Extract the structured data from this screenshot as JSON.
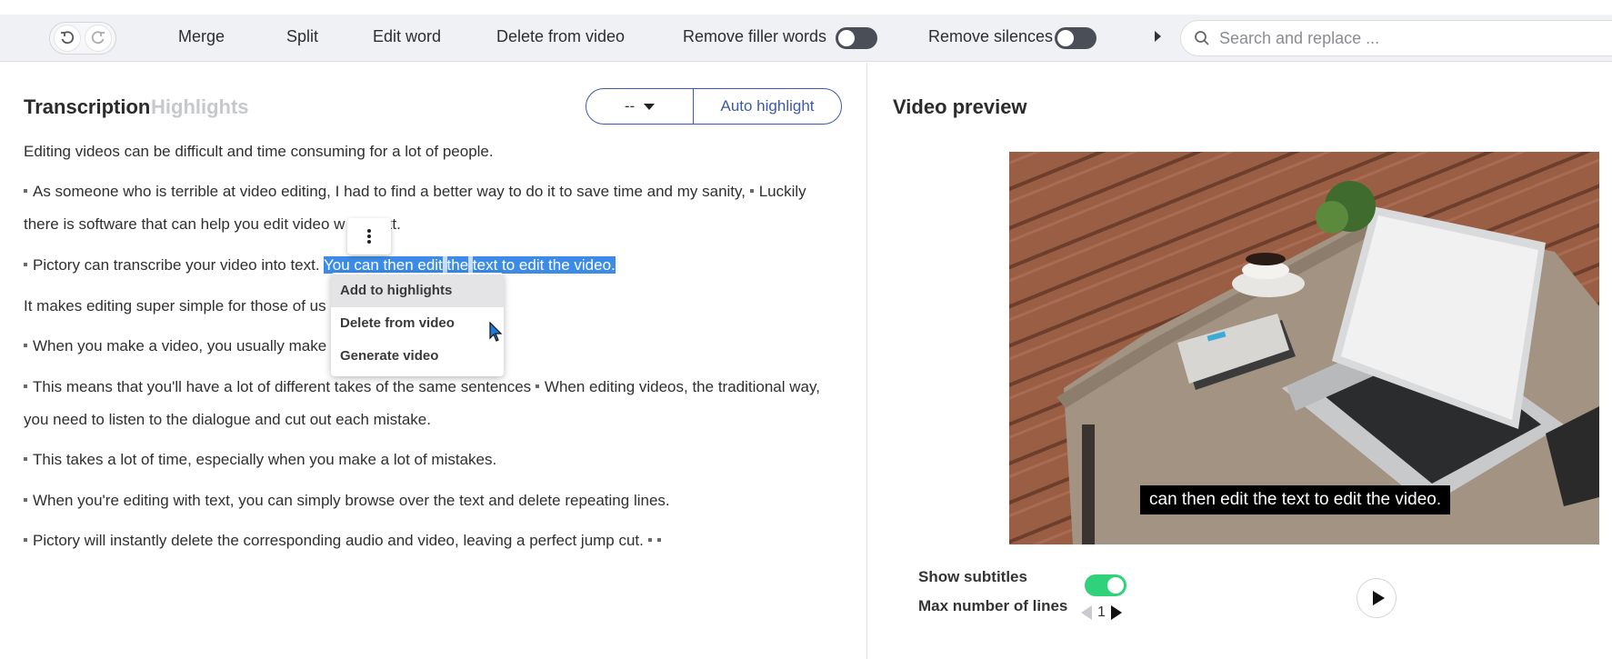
{
  "toolbar": {
    "merge": "Merge",
    "split": "Split",
    "edit_word": "Edit word",
    "delete_from_video": "Delete from video",
    "remove_filler_words": "Remove filler words",
    "remove_filler_words_on": false,
    "remove_silences": "Remove silences",
    "remove_silences_on": false,
    "search_placeholder": "Search and replace ..."
  },
  "transcription": {
    "tab_transcription": "Transcription",
    "tab_highlights": "Highlights",
    "highlight_select": "--",
    "auto_highlight": "Auto highlight",
    "p1": "Editing videos can be difficult and time consuming for a lot of people.",
    "p2a": "As someone who is terrible at video editing, I had to find a better way to do it to save time and my sanity,",
    "p2b": "Luckily",
    "p2c": "there is software that can help you edit video w",
    "p2d": "ext.",
    "p3a": "Pictory can transcribe your video into text.",
    "p3_sel1": "You can then edit",
    "p3_sel2": "the",
    "p3_sel3": "text to edit the video.",
    "p4": "It makes editing super simple for those of us",
    "p5": "When you make a video, you usually make a",
    "p6a": "This means that you'll have a lot of different takes of the same sentences",
    "p6b": "When editing videos, the traditional way,",
    "p6c": "you need to listen to the dialogue and cut out each mistake.",
    "p7": "This takes a lot of time, especially when you make a lot of mistakes.",
    "p8": "When you're editing with text, you can simply browse over the text and delete repeating lines.",
    "p9": "Pictory will instantly delete the corresponding audio and video, leaving a perfect jump cut."
  },
  "context_menu": {
    "items": [
      "Add to highlights",
      "Delete from video",
      "Generate video"
    ]
  },
  "preview": {
    "title": "Video preview",
    "subtitle_text": "can then edit the text to edit the video.",
    "show_subtitles_label": "Show subtitles",
    "show_subtitles_on": true,
    "max_lines_label": "Max number of lines",
    "max_lines_value": "1"
  },
  "colors": {
    "selection": "#3c8ce7",
    "accent": "#3d5aa8",
    "toggle_on": "#2fd17b"
  }
}
